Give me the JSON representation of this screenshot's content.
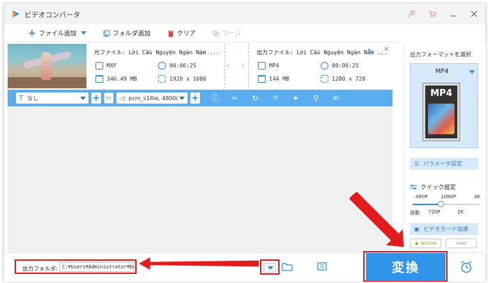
{
  "app": {
    "title": "ビデオコンバータ"
  },
  "toolbar": {
    "add_file": "ファイル追加",
    "add_folder": "フォルダ追加",
    "clear": "クリア",
    "merge": "マージ"
  },
  "file": {
    "source_label": "元ファイル:",
    "source_name": "Lời Cầu Nguyện Ngàn Năm ...",
    "source_format": "MXF",
    "source_duration": "00:06:25",
    "source_size": "346.49 MB",
    "source_resolution": "1920 x 1080",
    "output_label": "出力ファイル:",
    "output_name": "Lời Cầu Nguyện Ngàn Năm ...",
    "output_format": "MP4",
    "output_duration": "00:06:25",
    "output_size": "144 MB",
    "output_resolution": "1280 x 720"
  },
  "options": {
    "subtitle": "なし",
    "audio": "pcm_s16le, 4800("
  },
  "right_panel": {
    "title": "出力フォーマットを選択",
    "format": "MP4",
    "icon_text": "MP4",
    "params": "パラメータ設定",
    "quick": "クイック設定",
    "quality_top": [
      "480P",
      "1080P",
      "4K"
    ],
    "quality_bottom": [
      "自動",
      "720P",
      "2K"
    ],
    "quality_position": 0.42,
    "gpu_accel": "ビデオカード加速",
    "gpu_nvidia": "NVIDIA",
    "gpu_intel": "Intel"
  },
  "bottom": {
    "output_folder_label": "出力フォルダ:",
    "output_folder_path": "C:¥Users¥Administrator¥Desktop",
    "convert": "変換"
  },
  "colors": {
    "accent": "#2e95e8",
    "highlight": "#e21c1c",
    "option_bar": "#5aaef0"
  }
}
